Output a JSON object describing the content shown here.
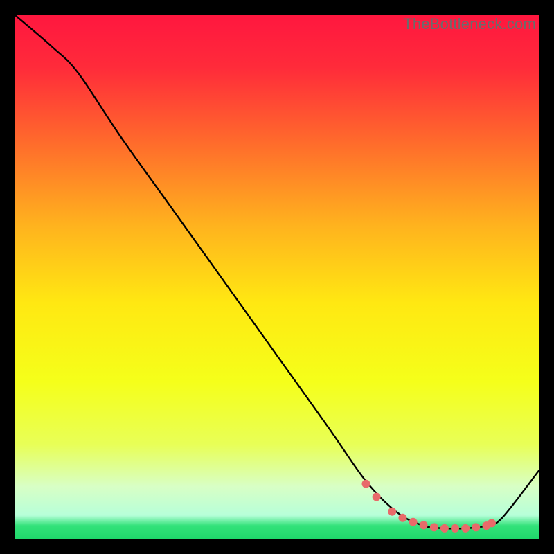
{
  "watermark": "TheBottleneck.com",
  "chart_data": {
    "type": "line",
    "title": "",
    "xlabel": "",
    "ylabel": "",
    "xlim": [
      0,
      100
    ],
    "ylim": [
      0,
      100
    ],
    "grid": false,
    "legend": false,
    "gradient_stops": [
      {
        "offset": 0.0,
        "color": "#ff173f"
      },
      {
        "offset": 0.1,
        "color": "#ff2b3a"
      },
      {
        "offset": 0.25,
        "color": "#ff6e2b"
      },
      {
        "offset": 0.4,
        "color": "#ffb21e"
      },
      {
        "offset": 0.55,
        "color": "#ffe812"
      },
      {
        "offset": 0.7,
        "color": "#f5ff1a"
      },
      {
        "offset": 0.82,
        "color": "#e8ff57"
      },
      {
        "offset": 0.9,
        "color": "#d8ffc5"
      },
      {
        "offset": 0.955,
        "color": "#b7ffd9"
      },
      {
        "offset": 0.975,
        "color": "#33e27a"
      },
      {
        "offset": 1.0,
        "color": "#1fd86b"
      }
    ],
    "curve": {
      "x": [
        0,
        7,
        12,
        20,
        30,
        40,
        50,
        60,
        67,
        73,
        78,
        82,
        86,
        90,
        93,
        100
      ],
      "y": [
        100,
        94,
        89,
        77,
        63,
        49,
        35,
        21,
        11,
        5,
        2.5,
        2,
        2,
        2.5,
        4,
        13
      ]
    },
    "markers": {
      "x": [
        67,
        69,
        72,
        74,
        76,
        78,
        80,
        82,
        84,
        86,
        88,
        90,
        91
      ],
      "y": [
        10.5,
        8.0,
        5.2,
        4.0,
        3.2,
        2.6,
        2.2,
        2.0,
        2.0,
        2.0,
        2.2,
        2.5,
        3.0
      ],
      "color": "#e86a6a",
      "radius": 6
    }
  }
}
